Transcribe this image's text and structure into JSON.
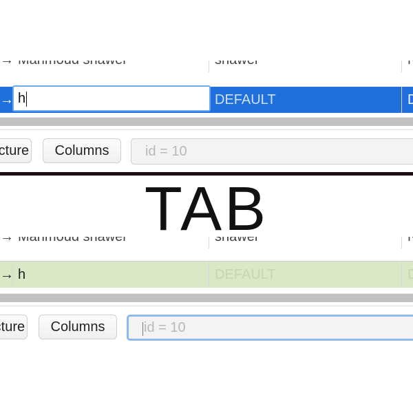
{
  "top_panel": {
    "rows": [
      {
        "arrow": "→",
        "name": "Mahmoud shawer",
        "col_c": "shawer",
        "col_d": "N"
      },
      {
        "arrow": "→",
        "name": "",
        "col_c": "DEFAULT",
        "col_d": "D"
      }
    ],
    "edit_value": "h",
    "toolbar": {
      "structure_label": "Structure",
      "columns_label": "Columns",
      "filter_placeholder": "id = 10"
    }
  },
  "divider_label": "TAB",
  "bottom_panel": {
    "rows": [
      {
        "arrow": "→",
        "name": "Mahmoud shawer",
        "col_c": "shawer",
        "col_d": "N"
      },
      {
        "arrow": "→",
        "name": "h",
        "col_c": "DEFAULT",
        "col_d": "D"
      }
    ],
    "toolbar": {
      "structure_label": "Structure",
      "columns_label": "Columns",
      "filter_placeholder": "id = 10"
    }
  },
  "colors": {
    "selection_blue": "#1f6fdc",
    "committed_green": "#dbe8c6",
    "focus_ring": "#8db9ef"
  }
}
